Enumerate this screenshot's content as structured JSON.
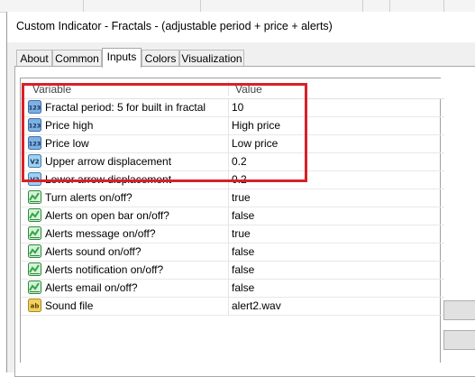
{
  "window": {
    "title": "Custom Indicator - Fractals - (adjustable period + price + alerts)"
  },
  "tabs": [
    {
      "label": "About",
      "active": false
    },
    {
      "label": "Common",
      "active": false
    },
    {
      "label": "Inputs",
      "active": true
    },
    {
      "label": "Colors",
      "active": false
    },
    {
      "label": "Visualization",
      "active": false
    }
  ],
  "grid": {
    "col_variable": "Variable",
    "col_value": "Value",
    "rows": [
      {
        "icon": "int-icon",
        "name": "Fractal period: 5 for built in fractal",
        "value": "10"
      },
      {
        "icon": "int-icon",
        "name": "Price high",
        "value": "High price"
      },
      {
        "icon": "int-icon",
        "name": "Price low",
        "value": "Low price"
      },
      {
        "icon": "double-icon",
        "name": "Upper arrow displacement",
        "value": "0.2"
      },
      {
        "icon": "double-icon",
        "name": "Lower arrow displacement",
        "value": "0.2"
      },
      {
        "icon": "bool-icon",
        "name": "Turn alerts on/off?",
        "value": "true"
      },
      {
        "icon": "bool-icon",
        "name": "Alerts on open bar on/off?",
        "value": "false"
      },
      {
        "icon": "bool-icon",
        "name": "Alerts message on/off?",
        "value": "true"
      },
      {
        "icon": "bool-icon",
        "name": "Alerts sound on/off?",
        "value": "false"
      },
      {
        "icon": "bool-icon",
        "name": "Alerts notification on/off?",
        "value": "false"
      },
      {
        "icon": "bool-icon",
        "name": "Alerts email on/off?",
        "value": "false"
      },
      {
        "icon": "string-icon",
        "name": "Sound file",
        "value": "alert2.wav"
      }
    ]
  },
  "colors": {
    "highlight_border": "#d92027",
    "int_icon_bg": "#7fb0e0",
    "double_icon_bg": "#9fd0f0",
    "bool_icon_bg": "#2fa84a",
    "string_icon_bg": "#f0d060"
  }
}
